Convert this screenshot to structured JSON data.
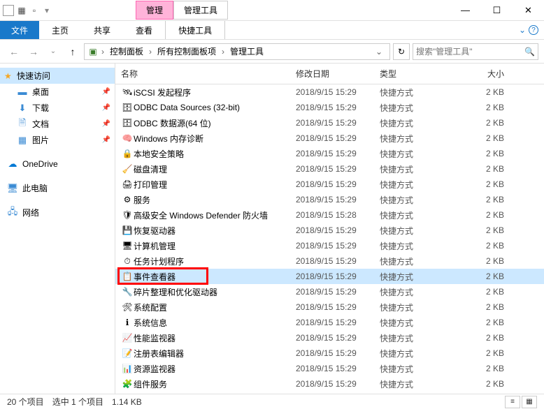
{
  "window": {
    "ribbon_context_tab": "管理",
    "ribbon_context_tab2": "管理工具"
  },
  "menu": {
    "file": "文件",
    "home": "主页",
    "share": "共享",
    "view": "查看",
    "shortcut_tools": "快捷工具"
  },
  "breadcrumb": {
    "items": [
      "控制面板",
      "所有控制面板项",
      "管理工具"
    ]
  },
  "search": {
    "placeholder": "搜索\"管理工具\""
  },
  "sidebar": {
    "quick_access": "快速访问",
    "desktop": "桌面",
    "downloads": "下载",
    "documents": "文档",
    "pictures": "图片",
    "onedrive": "OneDrive",
    "this_pc": "此电脑",
    "network": "网络"
  },
  "columns": {
    "name": "名称",
    "date": "修改日期",
    "type": "类型",
    "size": "大小"
  },
  "files": [
    {
      "name": "iSCSI 发起程序",
      "date": "2018/9/15 15:29",
      "type": "快捷方式",
      "size": "2 KB"
    },
    {
      "name": "ODBC Data Sources (32-bit)",
      "date": "2018/9/15 15:29",
      "type": "快捷方式",
      "size": "2 KB"
    },
    {
      "name": "ODBC 数据源(64 位)",
      "date": "2018/9/15 15:29",
      "type": "快捷方式",
      "size": "2 KB"
    },
    {
      "name": "Windows 内存诊断",
      "date": "2018/9/15 15:29",
      "type": "快捷方式",
      "size": "2 KB"
    },
    {
      "name": "本地安全策略",
      "date": "2018/9/15 15:29",
      "type": "快捷方式",
      "size": "2 KB"
    },
    {
      "name": "磁盘清理",
      "date": "2018/9/15 15:29",
      "type": "快捷方式",
      "size": "2 KB"
    },
    {
      "name": "打印管理",
      "date": "2018/9/15 15:29",
      "type": "快捷方式",
      "size": "2 KB"
    },
    {
      "name": "服务",
      "date": "2018/9/15 15:29",
      "type": "快捷方式",
      "size": "2 KB"
    },
    {
      "name": "高级安全 Windows Defender 防火墙",
      "date": "2018/9/15 15:28",
      "type": "快捷方式",
      "size": "2 KB"
    },
    {
      "name": "恢复驱动器",
      "date": "2018/9/15 15:29",
      "type": "快捷方式",
      "size": "2 KB"
    },
    {
      "name": "计算机管理",
      "date": "2018/9/15 15:29",
      "type": "快捷方式",
      "size": "2 KB"
    },
    {
      "name": "任务计划程序",
      "date": "2018/9/15 15:29",
      "type": "快捷方式",
      "size": "2 KB"
    },
    {
      "name": "事件查看器",
      "date": "2018/9/15 15:29",
      "type": "快捷方式",
      "size": "2 KB"
    },
    {
      "name": "碎片整理和优化驱动器",
      "date": "2018/9/15 15:29",
      "type": "快捷方式",
      "size": "2 KB"
    },
    {
      "name": "系统配置",
      "date": "2018/9/15 15:29",
      "type": "快捷方式",
      "size": "2 KB"
    },
    {
      "name": "系统信息",
      "date": "2018/9/15 15:29",
      "type": "快捷方式",
      "size": "2 KB"
    },
    {
      "name": "性能监视器",
      "date": "2018/9/15 15:29",
      "type": "快捷方式",
      "size": "2 KB"
    },
    {
      "name": "注册表编辑器",
      "date": "2018/9/15 15:29",
      "type": "快捷方式",
      "size": "2 KB"
    },
    {
      "name": "资源监视器",
      "date": "2018/9/15 15:29",
      "type": "快捷方式",
      "size": "2 KB"
    },
    {
      "name": "组件服务",
      "date": "2018/9/15 15:29",
      "type": "快捷方式",
      "size": "2 KB"
    }
  ],
  "selected_index": 12,
  "highlight_index": 12,
  "status": {
    "count": "20 个项目",
    "selection": "选中 1 个项目",
    "size": "1.14 KB"
  }
}
